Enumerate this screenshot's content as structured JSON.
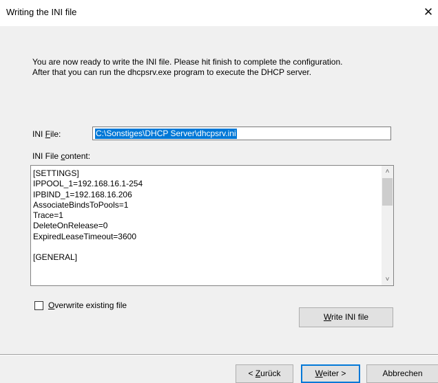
{
  "window": {
    "title": "Writing the INI file",
    "close_glyph": "✕"
  },
  "intro": {
    "line1": "You are now ready to write the INI file. Please hit finish to complete the configuration.",
    "line2": "After that you can run the dhcpsrv.exe program to execute the DHCP server."
  },
  "ini_file": {
    "label_prefix": "INI ",
    "label_accel": "F",
    "label_suffix": "ile:",
    "value": "C:\\Sonstiges\\DHCP Server\\dhcpsrv.ini"
  },
  "ini_content": {
    "label_prefix": "INI File ",
    "label_accel": "c",
    "label_suffix": "ontent:",
    "text": "[SETTINGS]\nIPPOOL_1=192.168.16.1-254\nIPBIND_1=192.168.16.206\nAssociateBindsToPools=1\nTrace=1\nDeleteOnRelease=0\nExpiredLeaseTimeout=3600\n\n[GENERAL]"
  },
  "overwrite": {
    "checked": false,
    "label_accel": "O",
    "label_rest": "verwrite existing file"
  },
  "buttons": {
    "write_accel": "W",
    "write_rest": "rite INI file",
    "back_prefix": "< ",
    "back_accel": "Z",
    "back_rest": "urück",
    "next_accel": "W",
    "next_rest": "eiter >",
    "cancel": "Abbrechen"
  },
  "icons": {
    "scroll_up": "chevron-up-icon",
    "scroll_down": "chevron-down-icon",
    "close": "close-icon"
  },
  "colors": {
    "selection": "#0078d7",
    "dialog_bg": "#f0f0f0",
    "default_button_border": "#0078d7"
  }
}
